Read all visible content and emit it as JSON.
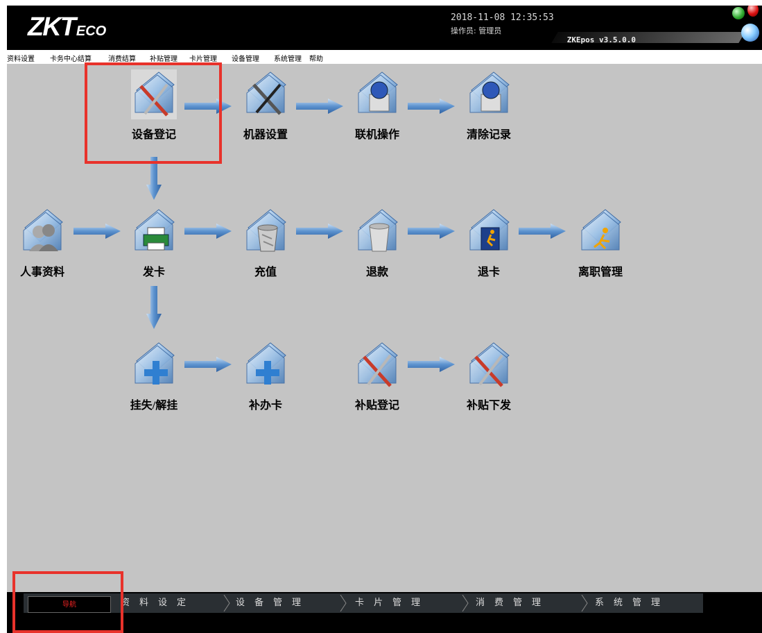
{
  "header": {
    "logo_main": "ZKT",
    "logo_sub": "ECO",
    "datetime": "2018-11-08 12:35:53",
    "operator": "操作员: 管理员",
    "version": "ZKEpos v3.5.0.0"
  },
  "menu": [
    "资料设置",
    "卡务中心结算",
    "消费结算",
    "补贴管理",
    "卡片管理",
    "设备管理",
    "系统管理",
    "帮助"
  ],
  "flow": {
    "device_register": {
      "label": "设备登记",
      "icon": "pencil-ruler-icon"
    },
    "machine_settings": {
      "label": "机器设置",
      "icon": "wrench-screwdriver-icon"
    },
    "online_operation": {
      "label": "联机操作",
      "icon": "globe-computer-icon"
    },
    "clear_records": {
      "label": "清除记录",
      "icon": "globe-computer-icon"
    },
    "personnel": {
      "label": "人事资料",
      "icon": "users-icon"
    },
    "issue_card": {
      "label": "发卡",
      "icon": "printer-icon"
    },
    "recharge": {
      "label": "充值",
      "icon": "trash-full-icon"
    },
    "refund": {
      "label": "退款",
      "icon": "trash-empty-icon"
    },
    "return_card": {
      "label": "退卡",
      "icon": "running-man-book-icon"
    },
    "resignation": {
      "label": "离职管理",
      "icon": "running-man-icon"
    },
    "report_loss": {
      "label": "挂失/解挂",
      "icon": "plus-icon"
    },
    "reissue_card": {
      "label": "补办卡",
      "icon": "plus-icon"
    },
    "subsidy_register": {
      "label": "补贴登记",
      "icon": "pencil-ruler-icon"
    },
    "subsidy_issue": {
      "label": "补贴下发",
      "icon": "pencil-ruler-icon"
    }
  },
  "bottom_tabs": {
    "nav": "导航",
    "tabs": [
      "资料设定",
      "设备管理",
      "卡片管理",
      "消费管理",
      "系统管理"
    ]
  },
  "colors": {
    "highlight": "#e8322b",
    "arrow": "#4f87c6"
  }
}
